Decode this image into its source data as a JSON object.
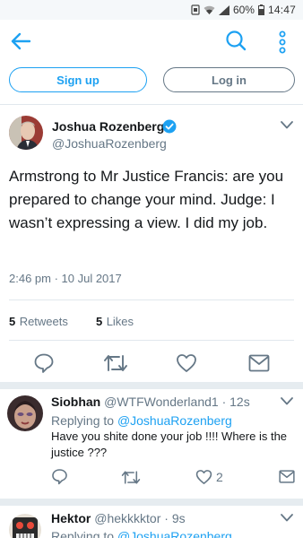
{
  "status_bar": {
    "battery": "60%",
    "time": "14:47"
  },
  "auth": {
    "signup_label": "Sign up",
    "login_label": "Log in"
  },
  "main_tweet": {
    "name": "Joshua Rozenberg",
    "handle": "@JoshuaRozenberg",
    "text": "Armstrong to Mr Justice Francis: are you prepared to change your mind. Judge: I wasn’t expressing a view. I did my job.",
    "timestamp": "2:46 pm · 10 Jul 2017",
    "retweets_count": "5",
    "retweets_label": "Retweets",
    "likes_count": "5",
    "likes_label": "Likes"
  },
  "replies": [
    {
      "name": "Siobhan",
      "handle": "@WTFWonderland1",
      "time": "· 12s",
      "replying_prefix": "Replying to",
      "replying_to": "@JoshuaRozenberg",
      "text": "Have you shite done your job !!!! Where is the justice ???",
      "like_count": "2"
    },
    {
      "name": "Hektor",
      "handle": "@hekkkktor",
      "time": "· 9s",
      "replying_prefix": "Replying to",
      "replying_to": "@JoshuaRozenberg"
    }
  ],
  "colors": {
    "accent": "#1da1f2",
    "muted": "#657786",
    "verified": "#1da1f2"
  },
  "icons": [
    "back-arrow-icon",
    "search-icon",
    "more-vertical-icon",
    "verified-badge-icon",
    "chevron-down-icon",
    "reply-icon",
    "retweet-icon",
    "like-icon",
    "share-icon"
  ]
}
